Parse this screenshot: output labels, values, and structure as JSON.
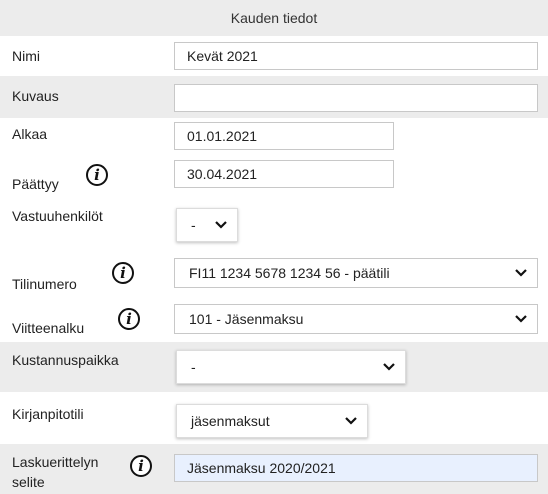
{
  "section": {
    "title": "Kauden tiedot"
  },
  "fields": {
    "nimi": {
      "label": "Nimi",
      "value": "Kevät 2021"
    },
    "kuvaus": {
      "label": "Kuvaus",
      "value": ""
    },
    "alkaa": {
      "label": "Alkaa",
      "value": "01.01.2021"
    },
    "paattyy": {
      "label": "Päättyy",
      "value": "30.04.2021"
    },
    "vastuuhenkilot": {
      "label": "Vastuuhenkilöt",
      "value": "-"
    },
    "tilinumero": {
      "label": "Tilinumero",
      "value": "FI11 1234 5678 1234 56 - päätili"
    },
    "viitteenalku": {
      "label": "Viitteenalku",
      "value": "101 - Jäsenmaksu"
    },
    "kustannuspaikka": {
      "label": "Kustannuspaikka",
      "value": "-"
    },
    "kirjanpitotili": {
      "label": "Kirjanpitotili",
      "value": "jäsenmaksut"
    },
    "laskuerittelyn_selite": {
      "label_line1": "Laskuerittelyn",
      "label_line2": "selite",
      "value": "Jäsenmaksu 2020/2021"
    }
  },
  "icons": {
    "info": "i"
  }
}
